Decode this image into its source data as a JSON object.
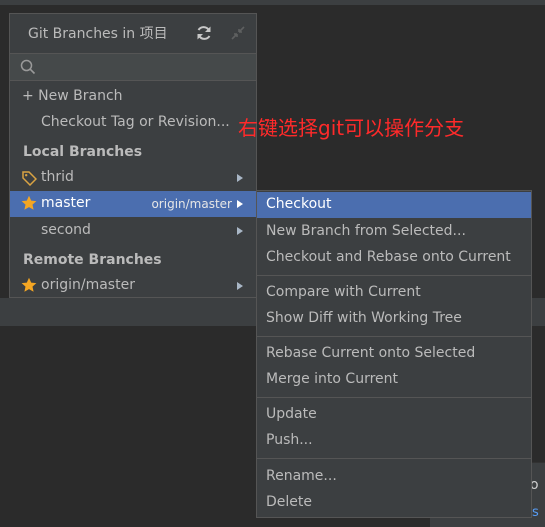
{
  "popup": {
    "title": "Git Branches in 项目",
    "search_placeholder": "",
    "actions": [
      {
        "label": "+ New Branch",
        "icon": "plus-icon"
      },
      {
        "label": "Checkout Tag or Revision..."
      }
    ],
    "local_header": "Local Branches",
    "local_branches": [
      {
        "name": "thrid",
        "icon": "tag-icon"
      },
      {
        "name": "master",
        "icon": "star-icon",
        "remote": "origin/master",
        "selected": true
      },
      {
        "name": "second"
      }
    ],
    "remote_header": "Remote Branches",
    "remote_branches": [
      {
        "name": "origin/master",
        "icon": "star-icon"
      }
    ]
  },
  "annotation": "右键选择git可以操作分支",
  "submenu": {
    "items": [
      {
        "label": "Checkout",
        "selected": true
      },
      {
        "label": "New Branch from Selected..."
      },
      {
        "label": "Checkout and Rebase onto Current"
      },
      {
        "label": "Compare with Current"
      },
      {
        "label": "Show Diff with Working Tree"
      },
      {
        "label": "Rebase Current onto Selected"
      },
      {
        "label": "Merge into Current"
      },
      {
        "label": "Update"
      },
      {
        "label": "Push..."
      },
      {
        "label": "Rename..."
      },
      {
        "label": "Delete"
      }
    ]
  },
  "background": {
    "partial_text": "o",
    "partial_link": "s"
  },
  "colors": {
    "selection": "#4b6eaf",
    "annotation": "#ff2a2a",
    "star": "#f4a623",
    "tag": "#d9a343"
  }
}
